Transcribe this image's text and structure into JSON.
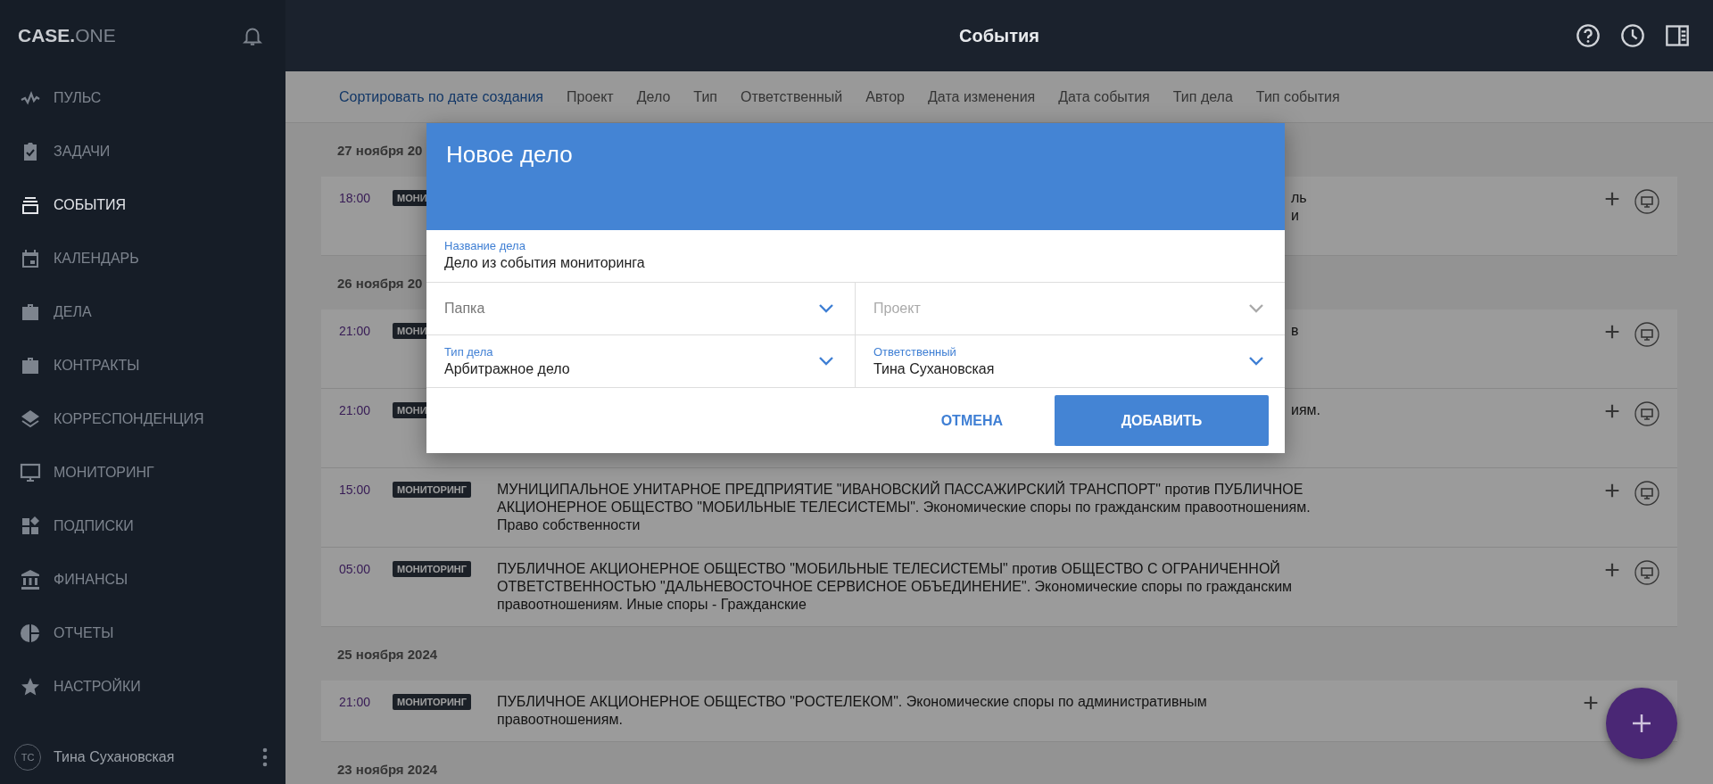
{
  "logo": {
    "main": "CASE.",
    "accent": "ONE"
  },
  "sidebar": {
    "items": [
      {
        "label": "ПУЛЬС",
        "selected": false
      },
      {
        "label": "ЗАДАЧИ",
        "selected": false
      },
      {
        "label": "СОБЫТИЯ",
        "selected": true
      },
      {
        "label": "КАЛЕНДАРЬ",
        "selected": false
      },
      {
        "label": "ДЕЛА",
        "selected": false
      },
      {
        "label": "КОНТРАКТЫ",
        "selected": false
      },
      {
        "label": "КОРРЕСПОНДЕНЦИЯ",
        "selected": false
      },
      {
        "label": "МОНИТОРИНГ",
        "selected": false
      },
      {
        "label": "ПОДПИСКИ",
        "selected": false
      },
      {
        "label": "ФИНАНСЫ",
        "selected": false
      },
      {
        "label": "ОТЧЕТЫ",
        "selected": false
      },
      {
        "label": "НАСТРОЙКИ",
        "selected": false
      }
    ],
    "user": {
      "initials": "ТС",
      "name": "Тина Сухановская"
    }
  },
  "header": {
    "title": "События"
  },
  "sort_bar": {
    "items": [
      {
        "label": "Сортировать по дате создания",
        "selected": true
      },
      {
        "label": "Проект",
        "selected": false
      },
      {
        "label": "Дело",
        "selected": false
      },
      {
        "label": "Тип",
        "selected": false
      },
      {
        "label": "Ответственный",
        "selected": false
      },
      {
        "label": "Автор",
        "selected": false
      },
      {
        "label": "Дата изменения",
        "selected": false
      },
      {
        "label": "Дата события",
        "selected": false
      },
      {
        "label": "Тип дела",
        "selected": false
      },
      {
        "label": "Тип события",
        "selected": false
      }
    ]
  },
  "groups": [
    {
      "date": "27 ноября 20",
      "events": [
        {
          "kind": "covered",
          "time": "18:00",
          "tag": "МОНИ",
          "lines": [
            "ль",
            "и"
          ]
        }
      ]
    },
    {
      "date": "26 ноября 20",
      "events": [
        {
          "kind": "covered",
          "time": "21:00",
          "tag": "МОНИ",
          "lines": [
            "в"
          ]
        },
        {
          "kind": "covered",
          "time": "21:00",
          "tag": "МОНИ",
          "lines": [
            "иям."
          ]
        },
        {
          "kind": "full",
          "time": "15:00",
          "tag": "МОНИТОРИНГ",
          "lines": [
            "МУНИЦИПАЛЬНОЕ УНИТАРНОЕ ПРЕДПРИЯТИЕ \"ИВАНОВСКИЙ ПАССАЖИРСКИЙ ТРАНСПОРТ\" против ПУБЛИЧНОЕ",
            "АКЦИОНЕРНОЕ ОБЩЕСТВО \"МОБИЛЬНЫЕ ТЕЛЕСИСТЕМЫ\". Экономические споры по гражданским правоотношениям.",
            "Право собственности"
          ]
        },
        {
          "kind": "full",
          "time": "05:00",
          "tag": "МОНИТОРИНГ",
          "lines": [
            "ПУБЛИЧНОЕ АКЦИОНЕРНОЕ ОБЩЕСТВО \"МОБИЛЬНЫЕ ТЕЛЕСИСТЕМЫ\" против ОБЩЕСТВО С ОГРАНИЧЕННОЙ",
            "ОТВЕТСТВЕННОСТЬЮ \"ДАЛЬНЕВОСТОЧНОЕ СЕРВИСНОЕ ОБЪЕДИНЕНИЕ\". Экономические споры по гражданским",
            "правоотношениям. Иные споры - Гражданские"
          ]
        }
      ]
    },
    {
      "date": "25 ноября 2024",
      "events": [
        {
          "kind": "full",
          "time": "21:00",
          "tag": "МОНИТОРИНГ",
          "lines": [
            "ПУБЛИЧНОЕ АКЦИОНЕРНОЕ ОБЩЕСТВО \"РОСТЕЛЕКОМ\". Экономические споры по административным",
            "правоотношениям."
          ]
        }
      ]
    },
    {
      "date": "23 ноября 2024"
    }
  ],
  "dialog": {
    "title": "Новое дело",
    "name_field": {
      "label": "Название дела",
      "value": "Дело из события мониторинга"
    },
    "selects": [
      {
        "label": "Папка",
        "disabled": false
      },
      {
        "label": "Проект",
        "disabled": true
      },
      {
        "label": "Тип дела",
        "value": "Арбитражное дело",
        "disabled": false
      },
      {
        "label": "Ответственный",
        "value": "Тина Сухановская",
        "disabled": false
      }
    ],
    "cancel": "ОТМЕНА",
    "submit": "ДОБАВИТЬ"
  }
}
